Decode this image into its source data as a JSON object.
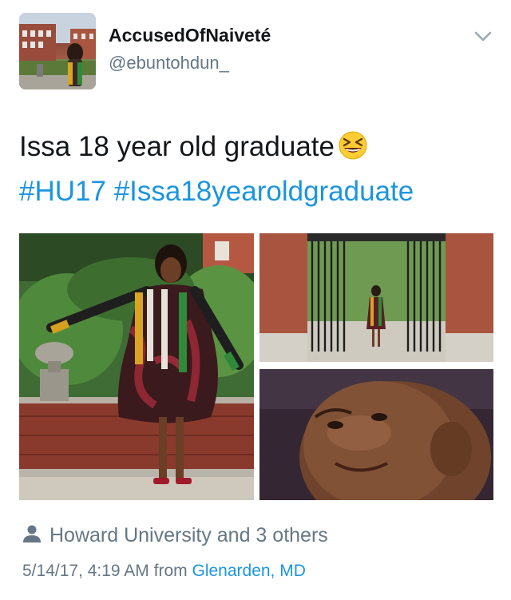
{
  "author": {
    "display_name": "AccusedOfNaiveté",
    "handle": "@ebuntohdun_"
  },
  "tweet": {
    "text": "Issa 18 year old graduate",
    "emoji": "grinning-squinting-face",
    "hashtags": [
      "#HU17",
      "#Issa18yearoldgraduate"
    ]
  },
  "media": [
    {
      "name": "graduate-twirl-photo"
    },
    {
      "name": "graduate-gate-photo"
    },
    {
      "name": "proud-child-meme-photo"
    }
  ],
  "location": {
    "tagged": "Howard University and 3 others"
  },
  "meta": {
    "timestamp": "5/14/17, 4:19 AM",
    "from_label": "from",
    "place": "Glenarden, MD"
  },
  "colors": {
    "link": "#1b95e0",
    "secondary": "#657786",
    "primary": "#14171a"
  },
  "icons": {
    "caret": "chevron-down-icon",
    "person": "person-icon"
  }
}
